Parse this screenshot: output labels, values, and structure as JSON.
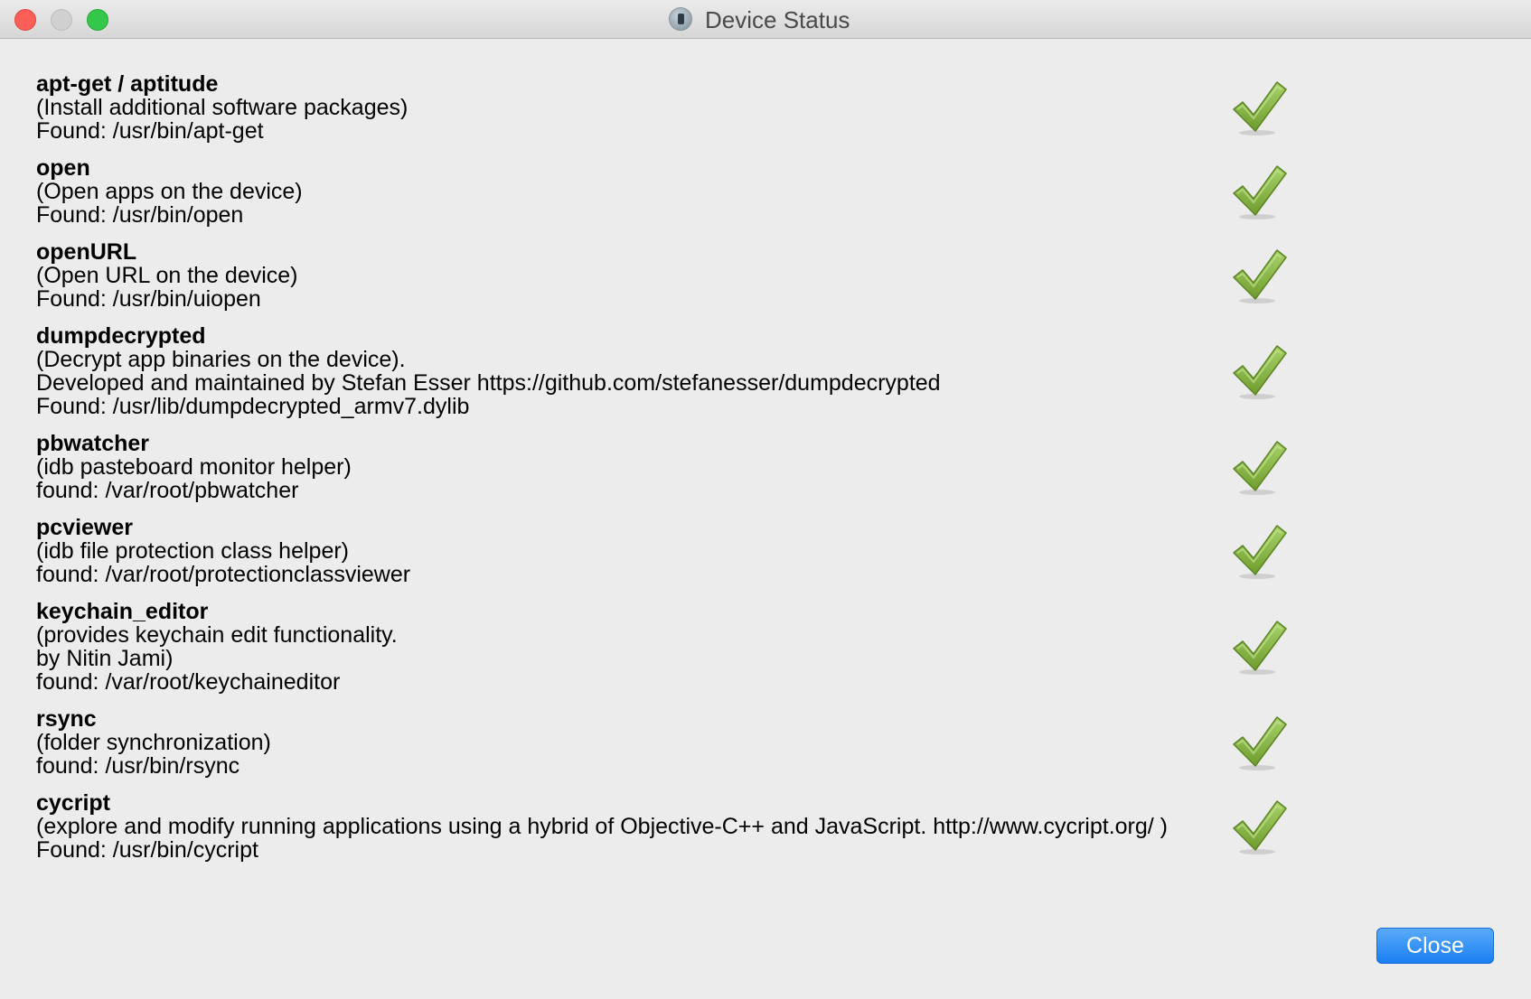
{
  "window": {
    "title": "Device Status",
    "title_icon": "device-icon",
    "traffic_lights": [
      "close",
      "minimize",
      "zoom"
    ]
  },
  "items": [
    {
      "name": "apt-get / aptitude",
      "lines": [
        "(Install additional software packages)",
        "Found: /usr/bin/apt-get"
      ],
      "status": "ok"
    },
    {
      "name": "open",
      "lines": [
        "(Open apps on the device)",
        "Found: /usr/bin/open"
      ],
      "status": "ok"
    },
    {
      "name": "openURL",
      "lines": [
        "(Open URL on the device)",
        "Found: /usr/bin/uiopen"
      ],
      "status": "ok"
    },
    {
      "name": "dumpdecrypted",
      "lines": [
        "(Decrypt app binaries on the device).",
        "Developed and maintained by Stefan Esser https://github.com/stefanesser/dumpdecrypted",
        "Found: /usr/lib/dumpdecrypted_armv7.dylib"
      ],
      "status": "ok"
    },
    {
      "name": "pbwatcher",
      "lines": [
        "(idb pasteboard monitor helper)",
        "found: /var/root/pbwatcher"
      ],
      "status": "ok"
    },
    {
      "name": "pcviewer",
      "lines": [
        "(idb file protection class helper)",
        "found: /var/root/protectionclassviewer"
      ],
      "status": "ok"
    },
    {
      "name": "keychain_editor",
      "lines": [
        "(provides keychain edit functionality.",
        "by Nitin Jami)",
        "found: /var/root/keychaineditor"
      ],
      "status": "ok"
    },
    {
      "name": "rsync",
      "lines": [
        "(folder synchronization)",
        "found: /usr/bin/rsync"
      ],
      "status": "ok"
    },
    {
      "name": "cycript",
      "lines": [
        "(explore and modify running applications using a hybrid of Objective-C++ and JavaScript. http://www.cycript.org/ )",
        "Found: /usr/bin/cycript"
      ],
      "status": "ok"
    }
  ],
  "check_icon": "checkmark-icon",
  "check_color": "#8fc04a",
  "buttons": {
    "close_label": "Close"
  },
  "colors": {
    "accent": "#1a7ff2",
    "background": "#ececec"
  }
}
